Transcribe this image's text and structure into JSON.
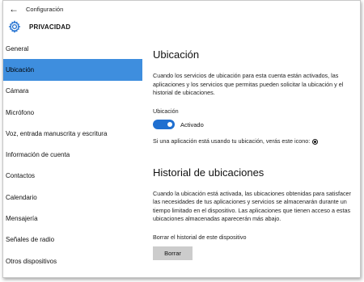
{
  "titlebar": {
    "title": "Configuración",
    "back_glyph": "←"
  },
  "header": {
    "title": "PRIVACIDAD",
    "icon": "gear-icon"
  },
  "sidebar": {
    "selected_index": 1,
    "accent_color": "#3e8ede",
    "items": [
      {
        "label": "General"
      },
      {
        "label": "Ubicación"
      },
      {
        "label": "Cámara"
      },
      {
        "label": "Micrófono"
      },
      {
        "label": "Voz, entrada manuscrita y escritura"
      },
      {
        "label": "Información de cuenta"
      },
      {
        "label": "Contactos"
      },
      {
        "label": "Calendario"
      },
      {
        "label": "Mensajería"
      },
      {
        "label": "Señales de radio"
      },
      {
        "label": "Otros dispositivos"
      }
    ]
  },
  "main": {
    "location": {
      "heading": "Ubicación",
      "description": "Cuando los servicios de ubicación para esta cuenta están activados, las aplicaciones y los servicios que permitas pueden solicitar la ubicación y el historial de ubicaciones.",
      "toggle_label": "Ubicación",
      "toggle_state": "Activado",
      "toggle_on": true,
      "toggle_color": "#1f6fd0",
      "icon_note": "Si una aplicación está usando tu ubicación, verás este icono:"
    },
    "history": {
      "heading": "Historial de ubicaciones",
      "description": "Cuando la ubicación está activada, las ubicaciones obtenidas para satisfacer las necesidades de tus aplicaciones y servicios se almacenarán durante un tiempo limitado en el dispositivo. Las aplicaciones que tienen acceso a estas ubicaciones almacenadas aparecerán más abajo.",
      "clear_label": "Borrar el historial de este dispositivo",
      "clear_button": "Borrar"
    }
  }
}
